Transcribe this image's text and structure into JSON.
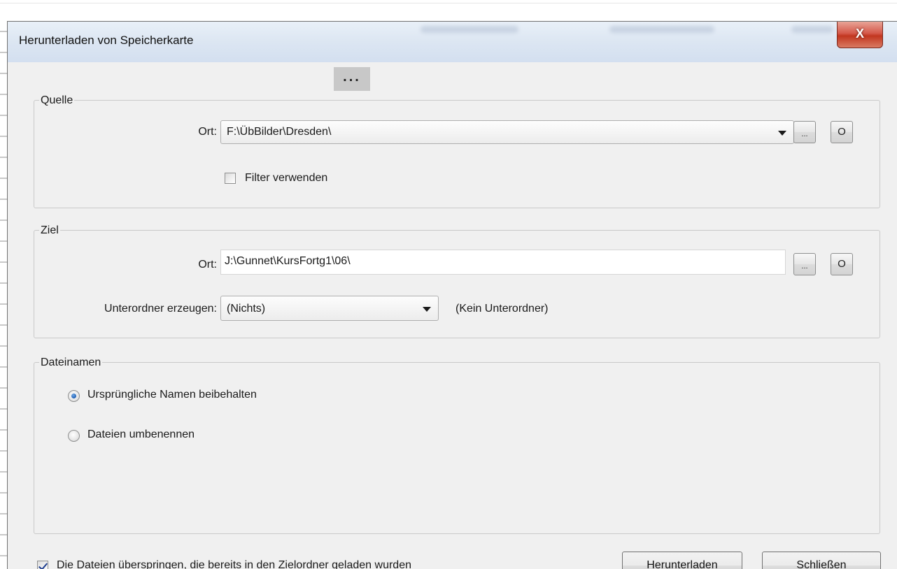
{
  "window": {
    "title": "Herunterladen von Speicherkarte",
    "close_label": "X"
  },
  "source": {
    "group_label": "Quelle",
    "location_label": "Ort:",
    "location_value": "F:\\ÜbBilder\\Dresden\\",
    "browse_label": "...",
    "open_label": "O",
    "filter_label": "Filter verwenden",
    "filter_checked": false
  },
  "target": {
    "group_label": "Ziel",
    "location_label": "Ort:",
    "location_value": "J:\\Gunnet\\KursFortg1\\06\\",
    "browse_label": "...",
    "open_label": "O",
    "subfolder_label": "Unterordner erzeugen:",
    "subfolder_value": "(Nichts)",
    "subfolder_hint": "(Kein Unterordner)"
  },
  "filenames": {
    "group_label": "Dateinamen",
    "options": [
      {
        "label": "Ursprüngliche Namen beibehalten",
        "selected": true
      },
      {
        "label": "Dateien umbenennen",
        "selected": false
      }
    ]
  },
  "footer": {
    "skip_label": "Die Dateien überspringen, die bereits in den Zielordner geladen wurden",
    "skip_checked": true,
    "download_label": "Herunterladen",
    "close_label": "Schließen"
  },
  "overlay": {
    "ellipsis": "..."
  }
}
